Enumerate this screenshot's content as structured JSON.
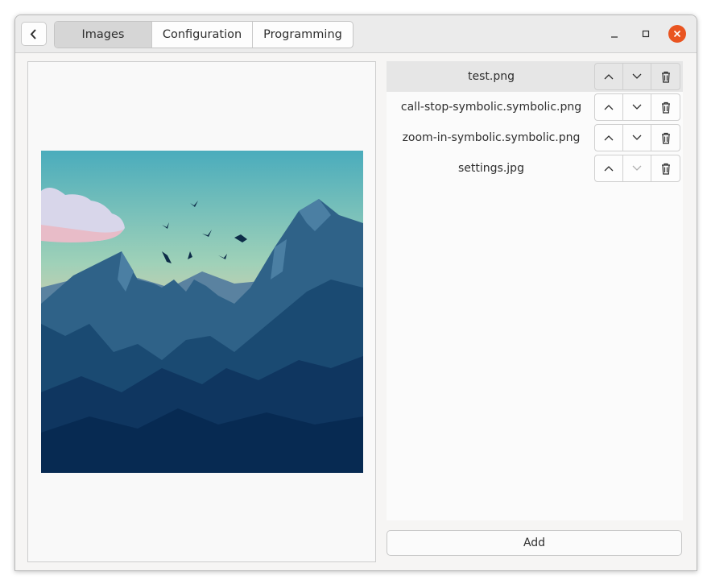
{
  "header": {
    "tabs": [
      {
        "label": "Images",
        "active": true
      },
      {
        "label": "Configuration",
        "active": false
      },
      {
        "label": "Programming",
        "active": false
      }
    ],
    "back_icon": "chevron-left-icon",
    "window_controls": [
      "minimize-icon",
      "maximize-icon",
      "close-icon"
    ],
    "close_color": "#e95420"
  },
  "preview": {
    "image_description_icon": "image-preview"
  },
  "images": {
    "items": [
      {
        "name": "test.png",
        "selected": true
      },
      {
        "name": "call-stop-symbolic.symbolic.png",
        "selected": false
      },
      {
        "name": "zoom-in-symbolic.symbolic.png",
        "selected": false
      },
      {
        "name": "settings.jpg",
        "selected": false
      }
    ],
    "row_icons": [
      "chevron-up-icon",
      "chevron-down-icon",
      "trash-icon"
    ]
  },
  "footer": {
    "add_label": "Add"
  }
}
